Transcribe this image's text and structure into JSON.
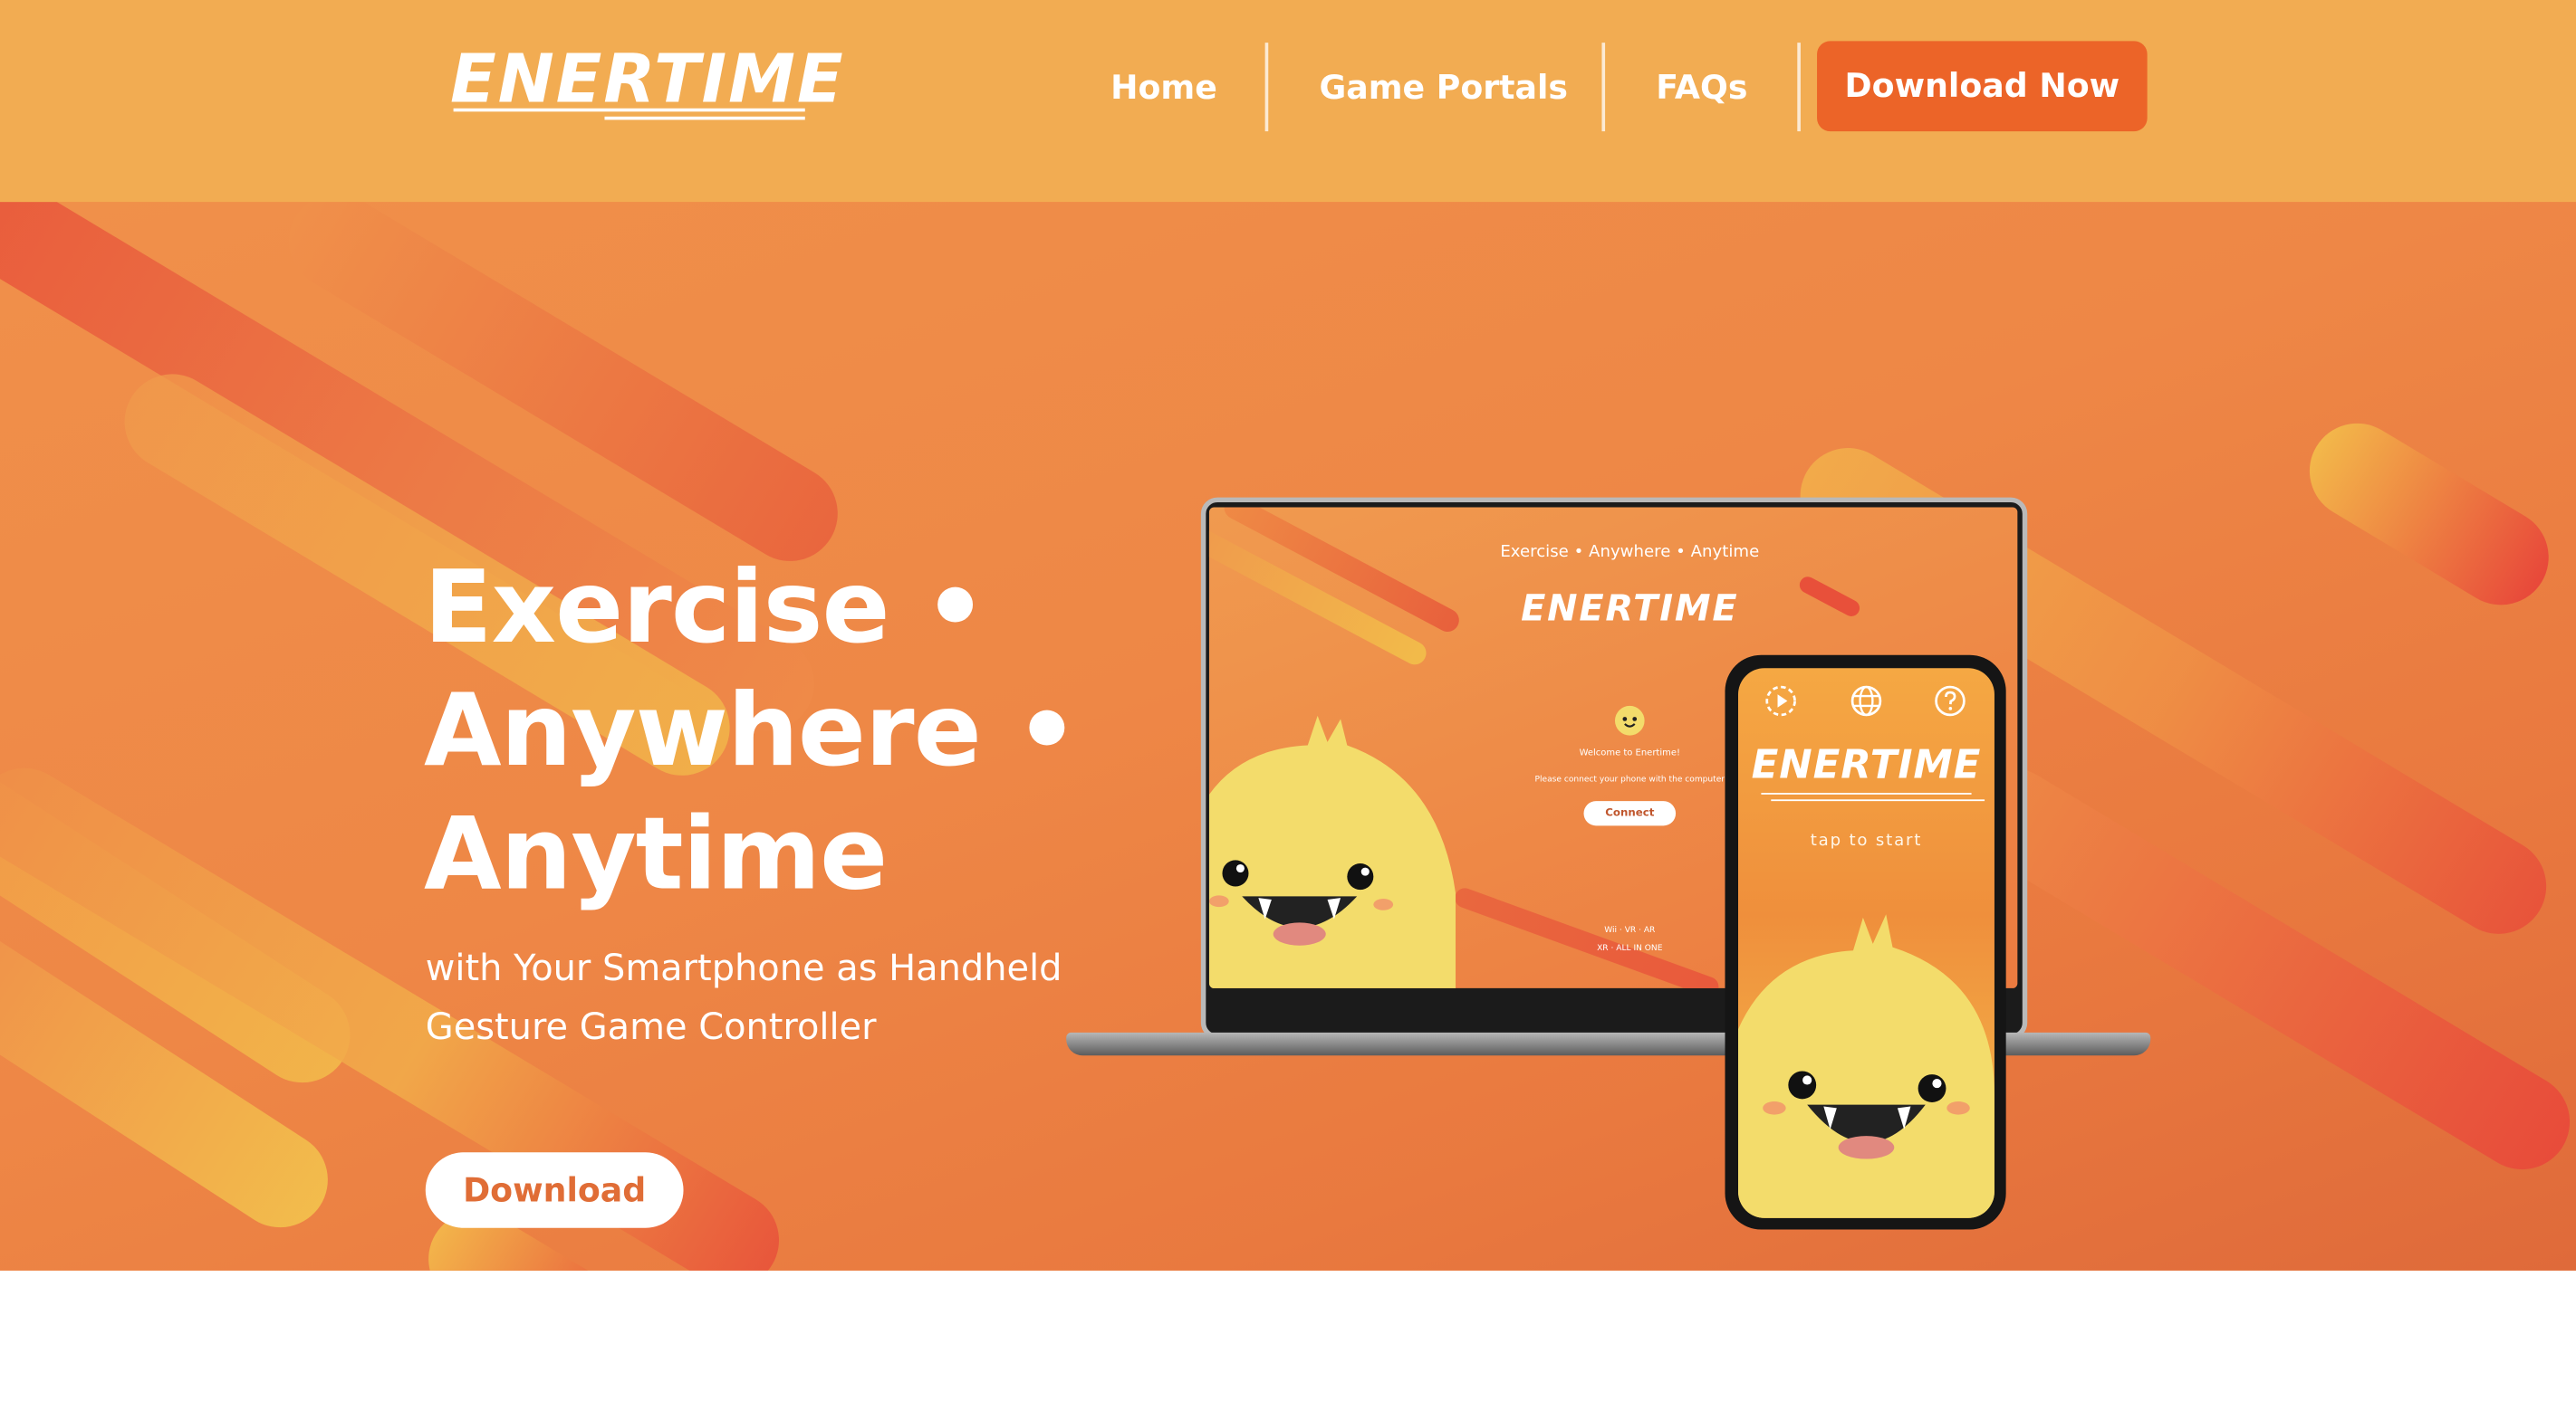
{
  "brand": {
    "logo_text": "ENERTIME"
  },
  "nav": {
    "items": [
      {
        "label": "Home"
      },
      {
        "label": "Game Portals"
      },
      {
        "label": "FAQs"
      }
    ],
    "cta_label": "Download Now"
  },
  "hero": {
    "title_lines": [
      "Exercise •",
      "Anywhere •",
      "Anytime"
    ],
    "subtitle": "with Your Smartphone as Handheld Gesture Game Controller",
    "button_label": "Download"
  },
  "laptop_screen": {
    "tagline": "Exercise • Anywhere • Anytime",
    "logo_text": "ENERTIME",
    "welcome": "Welcome to Enertime!",
    "instruction": "Please connect your phone with the computer",
    "connect_label": "Connect",
    "footer_line1": "Wii · VR · AR",
    "footer_line2": "XR · ALL IN ONE"
  },
  "phone_screen": {
    "logo_text": "ENERTIME",
    "prompt": "tap to start",
    "icons": [
      "play-icon",
      "globe-icon",
      "help-icon"
    ]
  },
  "colors": {
    "header_bg": "#f2ac52",
    "cta_bg": "#ec6428",
    "hero_bg": "#ee8746",
    "mascot": "#f3dc6b"
  }
}
